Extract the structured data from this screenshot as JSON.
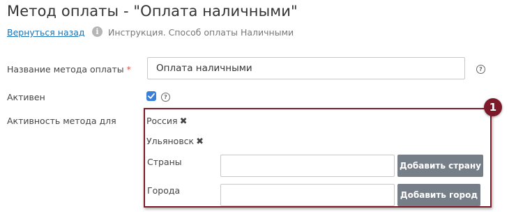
{
  "page": {
    "title": "Метод оплаты - \"Оплата наличными\"",
    "back_link": "Вернуться назад",
    "info_text": "Инструкция. Способ оплаты Наличными"
  },
  "form": {
    "name_label": "Название метода оплаты",
    "required_mark": "*",
    "name_value": "Оплата наличными",
    "active_label": "Активен",
    "active_checked": true,
    "activity_label": "Активность метода для",
    "help_icon": "question-circle-icon"
  },
  "activity": {
    "tags": [
      {
        "label": "Россия"
      },
      {
        "label": "Ульяновск"
      }
    ],
    "countries_label": "Страны",
    "countries_value": "",
    "add_country_button": "Добавить страну",
    "cities_label": "Города",
    "cities_value": "",
    "add_city_button": "Добавить город"
  },
  "annotation": {
    "badge": "1",
    "color": "#7d1a2a"
  },
  "colors": {
    "link": "#1a73b8",
    "checkbox": "#3b7fd9",
    "button": "#767f88",
    "required": "#d9534f"
  }
}
